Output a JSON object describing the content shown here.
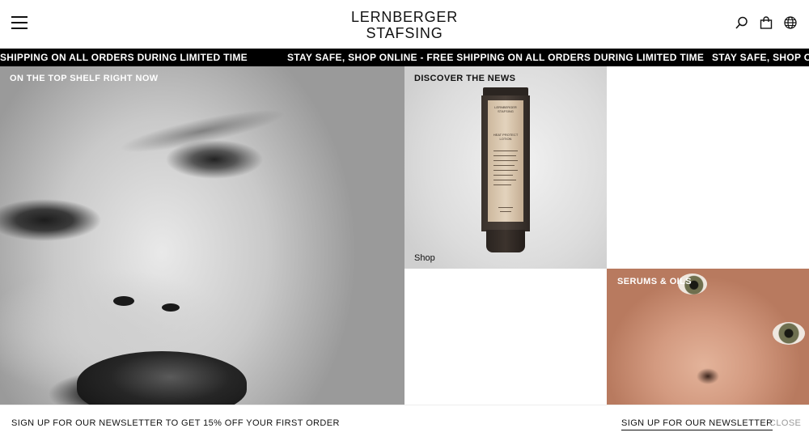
{
  "header": {
    "logo_line1": "LERNBERGER",
    "logo_line2": "STAFSING",
    "icons": [
      "menu-icon",
      "search-icon",
      "bag-icon",
      "globe-icon"
    ]
  },
  "ticker": {
    "items": [
      "SHIPPING ON ALL ORDERS DURING LIMITED TIME",
      "STAY SAFE, SHOP ONLINE - FREE SHIPPING ON ALL ORDERS DURING LIMITED TIME",
      "STAY SAFE, SHOP ONLIN"
    ]
  },
  "tiles": {
    "top_shelf": {
      "label": "ON THE TOP SHELF RIGHT NOW"
    },
    "news": {
      "label": "DISCOVER THE NEWS",
      "link": "Shop",
      "product_brand_1": "LERNBERGER",
      "product_brand_2": "STAFSING",
      "product_name_1": "HEAT PROTECT",
      "product_name_2": "LOTION"
    },
    "serums": {
      "label": "SERUMS & OILS"
    }
  },
  "newsletter": {
    "message": "SIGN UP FOR OUR NEWSLETTER TO GET 15% OFF YOUR FIRST ORDER",
    "signup_label": "SIGN UP FOR OUR NEWSLETTER",
    "close_label": "CLOSE"
  },
  "colors": {
    "ticker_bg": "#000000",
    "ticker_text": "#ffffff",
    "close_text": "#9a9a9a"
  }
}
